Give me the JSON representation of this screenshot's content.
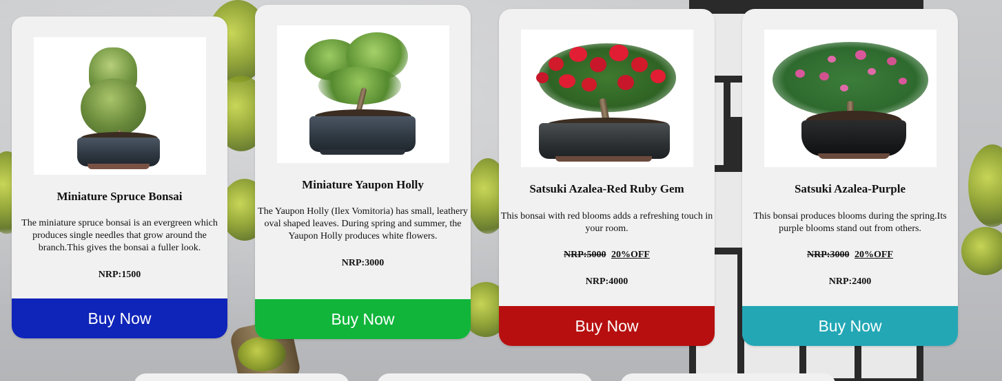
{
  "colors": {
    "card_bg": "#f1f1f1",
    "buy_blue": "#0f24b8",
    "buy_green": "#10b53a",
    "buy_red": "#b70f0f",
    "buy_teal": "#23a7b5"
  },
  "products": [
    {
      "title": "Miniature Spruce Bonsai",
      "description": "The miniature spruce bonsai is an evergreen which produces single needles that grow around the branch.This gives the bonsai a fuller look.",
      "old_price": "",
      "discount": "",
      "price": "NRP:1500",
      "button_label": "Buy Now",
      "button_color": "#0f24b8",
      "image_icon": "spruce-bonsai-image"
    },
    {
      "title": "Miniature Yaupon Holly",
      "description": "The Yaupon Holly (Ilex Vomitoria) has small, leathery oval shaped leaves. During spring and summer, the Yaupon Holly produces white flowers.",
      "old_price": "",
      "discount": "",
      "price": "NRP:3000",
      "button_label": "Buy Now",
      "button_color": "#10b53a",
      "image_icon": "yaupon-holly-image"
    },
    {
      "title": "Satsuki Azalea-Red Ruby Gem",
      "description": "This bonsai with red blooms adds a refreshing touch in your room.",
      "old_price": "NRP:5000",
      "discount": "20%OFF",
      "price": "NRP:4000",
      "button_label": "Buy Now",
      "button_color": "#b70f0f",
      "image_icon": "red-azalea-image"
    },
    {
      "title": "Satsuki Azalea-Purple",
      "description": "This bonsai produces blooms during the spring.Its purple blooms stand out from others.",
      "old_price": "NRP:3000",
      "discount": "20%OFF",
      "price": "NRP:2400",
      "button_label": "Buy Now",
      "button_color": "#23a7b5",
      "image_icon": "purple-azalea-image"
    }
  ]
}
